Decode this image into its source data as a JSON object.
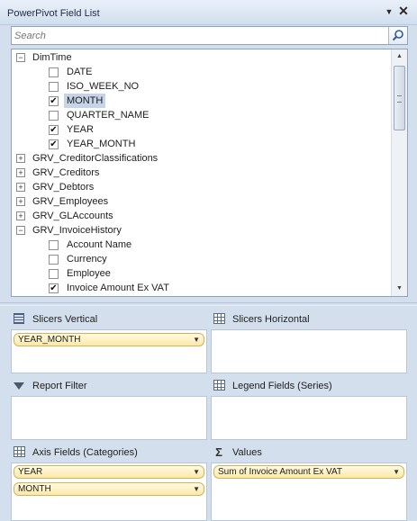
{
  "title": "PowerPivot Field List",
  "search": {
    "placeholder": "Search"
  },
  "tree": [
    {
      "type": "table",
      "label": "DimTime",
      "expander": "⊟"
    },
    {
      "type": "field",
      "label": "DATE",
      "checked": false
    },
    {
      "type": "field",
      "label": "ISO_WEEK_NO",
      "checked": false
    },
    {
      "type": "field",
      "label": "MONTH",
      "checked": true,
      "selected": true
    },
    {
      "type": "field",
      "label": "QUARTER_NAME",
      "checked": false
    },
    {
      "type": "field",
      "label": "YEAR",
      "checked": true
    },
    {
      "type": "field",
      "label": "YEAR_MONTH",
      "checked": true
    },
    {
      "type": "table",
      "label": "GRV_CreditorClassifications",
      "expander": "⊞"
    },
    {
      "type": "table",
      "label": "GRV_Creditors",
      "expander": "⊞"
    },
    {
      "type": "table",
      "label": "GRV_Debtors",
      "expander": "⊞"
    },
    {
      "type": "table",
      "label": "GRV_Employees",
      "expander": "⊞"
    },
    {
      "type": "table",
      "label": "GRV_GLAccounts",
      "expander": "⊞"
    },
    {
      "type": "table",
      "label": "GRV_InvoiceHistory",
      "expander": "⊟"
    },
    {
      "type": "field",
      "label": "Account Name",
      "checked": false
    },
    {
      "type": "field",
      "label": "Currency",
      "checked": false
    },
    {
      "type": "field",
      "label": "Employee",
      "checked": false
    },
    {
      "type": "field",
      "label": "Invoice Amount Ex VAT",
      "checked": true
    }
  ],
  "zones": {
    "slicers_vertical": {
      "label": "Slicers Vertical",
      "items": [
        "YEAR_MONTH"
      ]
    },
    "slicers_horizontal": {
      "label": "Slicers Horizontal",
      "items": []
    },
    "report_filter": {
      "label": "Report Filter",
      "items": []
    },
    "legend_fields": {
      "label": "Legend Fields (Series)",
      "items": []
    },
    "axis_fields": {
      "label": "Axis Fields (Categories)",
      "items": [
        "YEAR",
        "MONTH"
      ]
    },
    "values": {
      "label": "Values",
      "items": [
        "Sum of Invoice Amount Ex VAT"
      ]
    }
  },
  "icons": {
    "dropdown": "▼",
    "close": "✕",
    "checkmark": "✔",
    "values": "Σ",
    "pill_arrow": "▼",
    "scroll_up": "▲",
    "scroll_down": "▼"
  }
}
